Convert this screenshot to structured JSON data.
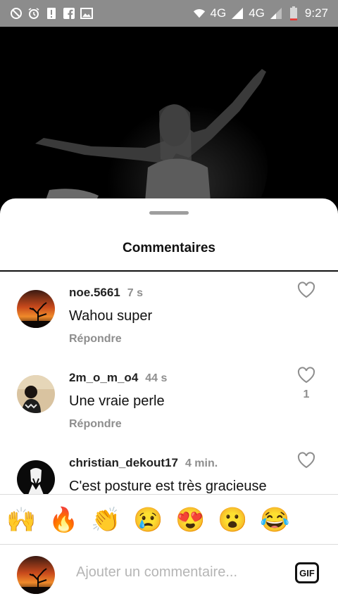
{
  "status_bar": {
    "network_left": "4G",
    "network_right": "4G",
    "time": "9:27",
    "icons_left": [
      "blocked-icon",
      "alarm-icon",
      "alert-icon",
      "facebook-icon",
      "gallery-icon"
    ],
    "icons_right": [
      "wifi-icon",
      "signal-icon",
      "signal-icon",
      "battery-icon"
    ],
    "battery_level": 0.15
  },
  "sheet": {
    "title": "Commentaires"
  },
  "comments": [
    {
      "username": "noe.5661",
      "time": "7 s",
      "text": "Wahou super",
      "reply_label": "Répondre",
      "likes": ""
    },
    {
      "username": "2m_o_m_o4",
      "time": "44 s",
      "text": "Une vraie perle",
      "reply_label": "Répondre",
      "likes": "1"
    },
    {
      "username": "christian_dekout17",
      "time": "4 min.",
      "text": "C'est posture est très gracieuse",
      "reply_label": "",
      "likes": ""
    }
  ],
  "emoji_bar": [
    {
      "name": "raising-hands-emoji",
      "glyph": "🙌"
    },
    {
      "name": "fire-emoji",
      "glyph": "🔥"
    },
    {
      "name": "clapping-hands-emoji",
      "glyph": "👏"
    },
    {
      "name": "sad-face-emoji",
      "glyph": "😢"
    },
    {
      "name": "heart-eyes-emoji",
      "glyph": "😍"
    },
    {
      "name": "surprised-face-emoji",
      "glyph": "😮"
    },
    {
      "name": "laughing-face-emoji",
      "glyph": "😂"
    }
  ],
  "composer": {
    "placeholder": "Ajouter un commentaire...",
    "gif_label": "GIF"
  },
  "colors": {
    "status_bar_bg": "#8c8c8c",
    "secondary_text": "#8e8e8e",
    "divider": "#dbdbdb"
  }
}
